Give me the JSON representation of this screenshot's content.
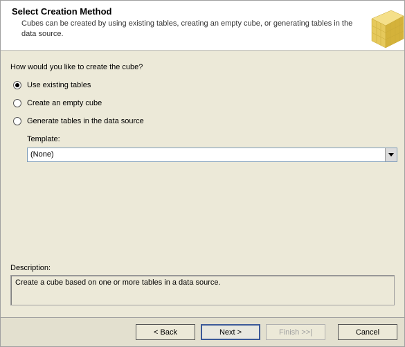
{
  "header": {
    "title": "Select Creation Method",
    "description": "Cubes can be created by using existing tables, creating an empty cube, or generating tables in the data source.",
    "icon_name": "cube-icon"
  },
  "question": "How would you like to create the cube?",
  "options": {
    "use_existing": "Use existing tables",
    "create_empty": "Create an empty cube",
    "generate_tables": "Generate tables in the data source"
  },
  "selected_option": "use_existing",
  "template": {
    "label": "Template:",
    "value": "(None)"
  },
  "description_section": {
    "label": "Description:",
    "text": "Create a cube based on one or more tables in a data source."
  },
  "buttons": {
    "back": "< Back",
    "next": "Next >",
    "finish": "Finish >>|",
    "cancel": "Cancel"
  }
}
